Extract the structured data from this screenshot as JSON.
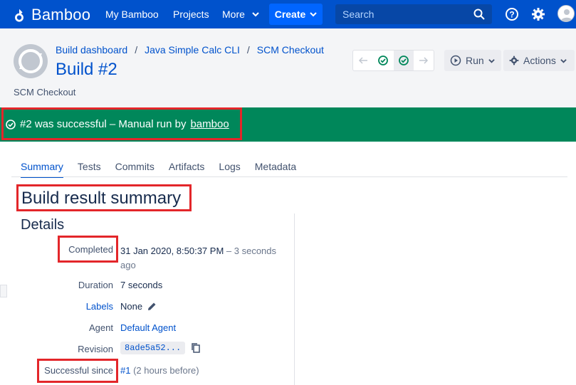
{
  "topnav": {
    "app_name": "Bamboo",
    "links": [
      "My Bamboo",
      "Projects",
      "More"
    ],
    "create_label": "Create",
    "search_placeholder": "Search"
  },
  "header": {
    "breadcrumb": [
      "Build dashboard",
      "Java Simple Calc CLI",
      "SCM Checkout"
    ],
    "title": "Build #2",
    "subtitle": "SCM Checkout",
    "run_label": "Run",
    "actions_label": "Actions"
  },
  "banner": {
    "text": "#2 was successful – Manual run by",
    "user": "bamboo"
  },
  "tabs": [
    "Summary",
    "Tests",
    "Commits",
    "Artifacts",
    "Logs",
    "Metadata"
  ],
  "summary": {
    "title": "Build result summary",
    "details_heading": "Details",
    "rows": [
      {
        "label": "Completed",
        "value": "31 Jan 2020, 8:50:37 PM",
        "extra": "– 3 seconds",
        "extra2": "ago"
      },
      {
        "label": "Duration",
        "value": "7 seconds"
      },
      {
        "label": "Labels",
        "value": "None"
      },
      {
        "label": "Agent",
        "value": "Default Agent"
      },
      {
        "label": "Revision",
        "value": "8ade5a52..."
      },
      {
        "label": "Successful since",
        "value": "#1",
        "extra": "(2 hours before)"
      }
    ]
  },
  "colors": {
    "nav_bg": "#0052cc",
    "success_green": "#00875a",
    "highlight_red": "#e3262a",
    "link_blue": "#0052cc"
  }
}
